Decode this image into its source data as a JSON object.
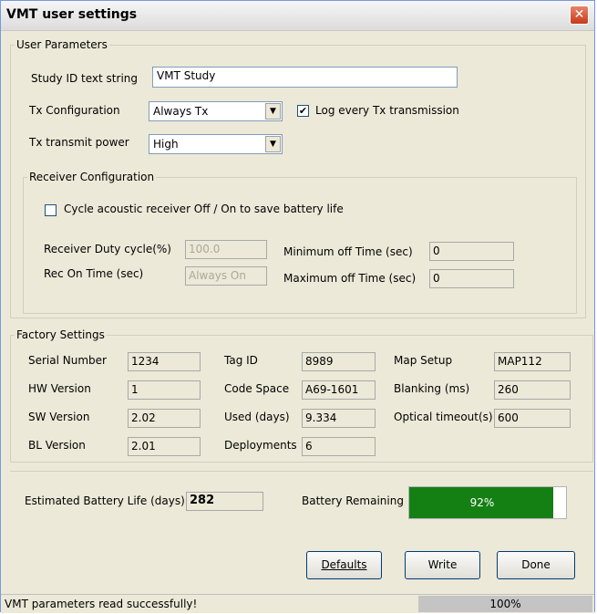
{
  "window": {
    "title": "VMT user settings",
    "close_glyph": "✕"
  },
  "user_params": {
    "legend": "User Parameters",
    "study_label": "Study ID text string",
    "study_value": "VMT Study",
    "tx_config_label": "Tx Configuration",
    "tx_config_value": "Always Tx",
    "log_label": "Log every Tx transmission",
    "log_checked": true,
    "tx_power_label": "Tx transmit power",
    "tx_power_value": "High"
  },
  "receiver": {
    "legend": "Receiver Configuration",
    "cycle_label": "Cycle acoustic receiver Off / On to save battery life",
    "cycle_checked": false,
    "duty_label": "Receiver Duty cycle(%)",
    "duty_value": "100.0",
    "on_time_label": "Rec On Time (sec)",
    "on_time_value": "Always On",
    "min_off_label": "Minimum off Time (sec)",
    "min_off_value": "0",
    "max_off_label": "Maximum off Time (sec)",
    "max_off_value": "0"
  },
  "factory": {
    "legend": "Factory Settings",
    "serial_label": "Serial Number",
    "serial_value": "1234",
    "hw_label": "HW Version",
    "hw_value": "1",
    "sw_label": "SW Version",
    "sw_value": "2.02",
    "bl_label": "BL Version",
    "bl_value": "2.01",
    "tag_label": "Tag ID",
    "tag_value": "8989",
    "codespace_label": "Code Space",
    "codespace_value": "A69-1601",
    "used_label": "Used (days)",
    "used_value": "9.334",
    "deploy_label": "Deployments",
    "deploy_value": "6",
    "map_label": "Map Setup",
    "map_value": "MAP112",
    "blanking_label": "Blanking (ms)",
    "blanking_value": "260",
    "optical_label": "Optical timeout(s)",
    "optical_value": "600"
  },
  "battery": {
    "life_label": "Estimated Battery Life (days)",
    "life_value": "282",
    "remaining_label": "Battery Remaining",
    "remaining_text": "92%",
    "remaining_fraction": 0.92,
    "fill_color": "#148014"
  },
  "buttons": {
    "defaults": "Defaults",
    "write": "Write",
    "done": "Done"
  },
  "status": {
    "message": "VMT parameters read successfully!",
    "progress_text": "100%"
  }
}
